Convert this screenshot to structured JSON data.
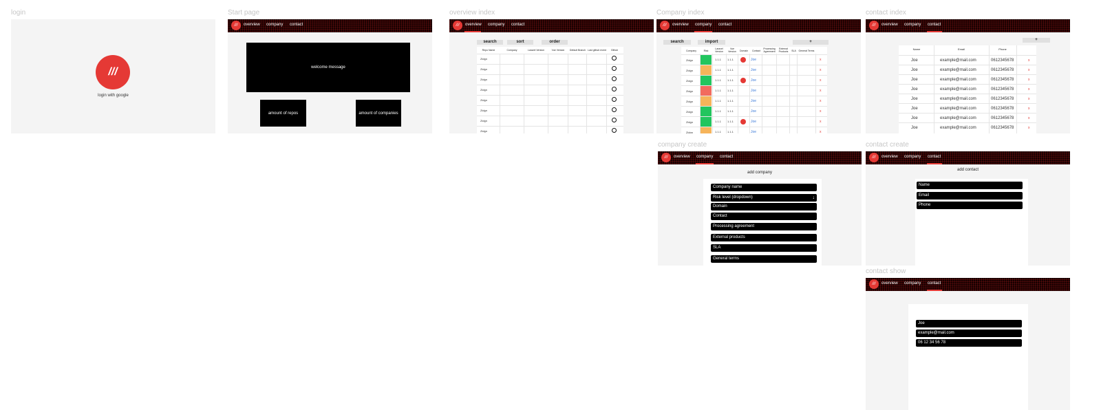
{
  "brand": {
    "logo_text": "///",
    "accent": "#e53935",
    "nav_bg": "#120000"
  },
  "nav": {
    "overview": "overview",
    "company": "company",
    "contact": "contact"
  },
  "frames": {
    "login": {
      "label": "login",
      "button_text": "login with google"
    },
    "start": {
      "label": "Start page",
      "welcome": "welcome message",
      "repos": "amount of repos",
      "companies": "amount of companies"
    },
    "overview_index": {
      "label": "overview index",
      "controls": {
        "search": "search",
        "sort": "sort",
        "order": "order"
      },
      "columns": [
        "Repo Name",
        "Company",
        "Laravel Version",
        "Vue Version",
        "Default Branch",
        "Last github event",
        "Github"
      ],
      "rows": [
        "Zidgn",
        "Zidgn",
        "Zidgn",
        "Zidgn",
        "Zidgn",
        "Zidgn",
        "Zidgn",
        "Zidgn"
      ]
    },
    "company_index": {
      "label": "Company index",
      "controls": {
        "search": "search",
        "import": "import",
        "add": "+"
      },
      "columns": [
        "Company",
        "Risk",
        "Laravel Version",
        "Vue Version",
        "Domain",
        "Contact",
        "Processing Agreement",
        "External Products",
        "SLA",
        "General Terms"
      ],
      "rows": [
        {
          "company": "Zidgn",
          "risk": "#22c55e",
          "laravel": "1.1.1",
          "vue": "1.1.1",
          "domain_badge": true,
          "contact": "Joe"
        },
        {
          "company": "Zidgn",
          "risk": "#f6b45a",
          "laravel": "1.1.1",
          "vue": "1.1.1",
          "domain_badge": false,
          "contact": "Joe"
        },
        {
          "company": "Zidgn",
          "risk": "#22c55e",
          "laravel": "1.1.1",
          "vue": "1.1.1",
          "domain_badge": true,
          "contact": "Joe"
        },
        {
          "company": "Zidgn",
          "risk": "#f26b5e",
          "laravel": "1.1.1",
          "vue": "1.1.1",
          "domain_badge": false,
          "contact": "Joe"
        },
        {
          "company": "Zidgn",
          "risk": "#f6b45a",
          "laravel": "1.1.1",
          "vue": "1.1.1",
          "domain_badge": false,
          "contact": "Joe"
        },
        {
          "company": "Zidgn",
          "risk": "#22c55e",
          "laravel": "1.1.1",
          "vue": "1.1.1",
          "domain_badge": false,
          "contact": "Joe"
        },
        {
          "company": "Zidgn",
          "risk": "#22c55e",
          "laravel": "1.1.1",
          "vue": "1.1.1",
          "domain_badge": true,
          "contact": "Joe"
        },
        {
          "company": "Zidgn",
          "risk": "#f6b45a",
          "laravel": "1.1.1",
          "vue": "1.1.1",
          "domain_badge": false,
          "contact": "Joe"
        }
      ],
      "delete_symbol": "x"
    },
    "contact_index": {
      "label": "contact index",
      "add": "+",
      "columns": [
        "Name",
        "Email",
        "Phone"
      ],
      "rows": [
        {
          "name": "Joe",
          "email": "example@mail.com",
          "phone": "0612345678"
        },
        {
          "name": "Joe",
          "email": "example@mail.com",
          "phone": "0612345678"
        },
        {
          "name": "Joe",
          "email": "example@mail.com",
          "phone": "0612345678"
        },
        {
          "name": "Joe",
          "email": "example@mail.com",
          "phone": "0612345678"
        },
        {
          "name": "Joe",
          "email": "example@mail.com",
          "phone": "0612345678"
        },
        {
          "name": "Joe",
          "email": "example@mail.com",
          "phone": "0612345678"
        },
        {
          "name": "Joe",
          "email": "example@mail.com",
          "phone": "0612345678"
        },
        {
          "name": "Joe",
          "email": "example@mail.com",
          "phone": "0612345678"
        }
      ],
      "delete_symbol": "x"
    },
    "company_create": {
      "label": "company create",
      "title": "add company",
      "fields": [
        "Company name",
        "Risk level (dropdown)",
        "Domain",
        "Contact",
        "Processing agreement",
        "External products",
        "SLA",
        "General terms"
      ]
    },
    "contact_create": {
      "label": "contact create",
      "title": "add contact",
      "fields": [
        "Name",
        "Email",
        "Phone"
      ]
    },
    "contact_show": {
      "label": "contact show",
      "fields": [
        "Joe",
        "example@mail.com",
        "06 12 34 56 78"
      ]
    }
  }
}
